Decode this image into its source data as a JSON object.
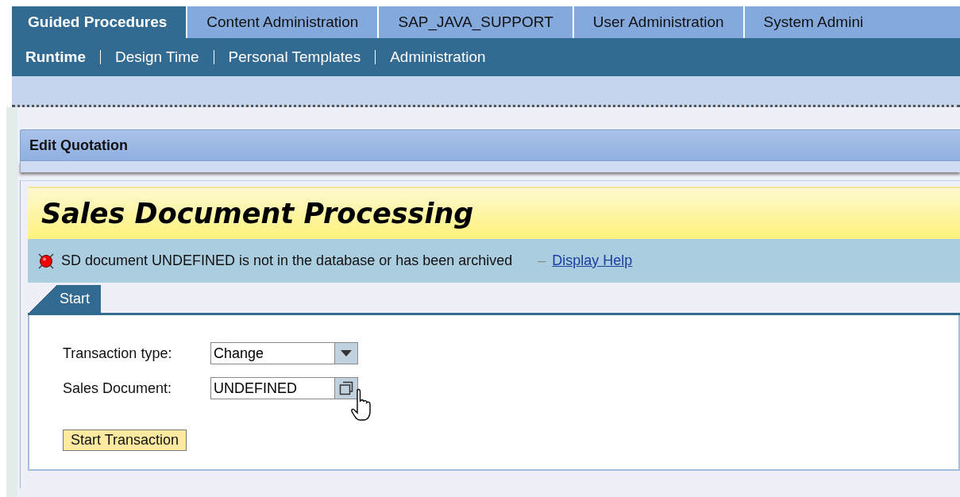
{
  "top_tabs": [
    {
      "label": "Guided Procedures",
      "selected": true
    },
    {
      "label": "Content Administration",
      "selected": false
    },
    {
      "label": "SAP_JAVA_SUPPORT",
      "selected": false
    },
    {
      "label": "User Administration",
      "selected": false
    },
    {
      "label": "System Admini",
      "selected": false
    }
  ],
  "sub_nav": [
    {
      "label": "Runtime",
      "selected": true
    },
    {
      "label": "Design Time",
      "selected": false
    },
    {
      "label": "Personal Templates",
      "selected": false
    },
    {
      "label": "Administration",
      "selected": false
    }
  ],
  "panel": {
    "title": "Edit Quotation"
  },
  "app": {
    "title": "Sales Document Processing",
    "message": {
      "kind": "error",
      "text": "SD document UNDEFINED is not in the database or has been archived",
      "help_prefix": "–",
      "help_link": "Display Help"
    },
    "tabs": [
      {
        "label": "Start",
        "selected": true
      }
    ],
    "fields": [
      {
        "kind": "dropdown",
        "label": "Transaction type:",
        "value": "Change"
      },
      {
        "kind": "valuehelp",
        "label": "Sales Document:",
        "value": "UNDEFINED"
      }
    ],
    "button": "Start Transaction"
  }
}
